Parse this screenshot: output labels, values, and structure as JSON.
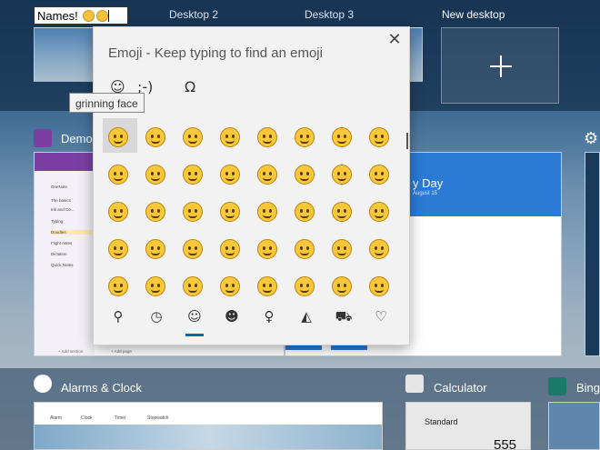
{
  "desktops": {
    "rename_value": "Names!",
    "desktop2": "Desktop 2",
    "desktop3": "Desktop 3",
    "new_desktop": "New desktop"
  },
  "windows": {
    "onenote_title": "Demo",
    "alarms_title": "Alarms & Clock",
    "calculator_title": "Calculator",
    "bing_title": "Bing",
    "calc_mode": "Standard",
    "calc_display": "555",
    "todo_header": "y Day",
    "todo_sub": "August 15",
    "onenote_pages": [
      "OneNote",
      "The basics",
      "Ink and Co...",
      "Typing",
      "Doodles",
      "Flight notes",
      "Dictation",
      "Quick Notes"
    ],
    "onenote_add_section": "+ Add section",
    "onenote_add_page": "+ Add page",
    "alarms_tabs": [
      "Alarm",
      "Clock",
      "Timer",
      "Stopwatch"
    ]
  },
  "emoji_panel": {
    "title": "Emoji - Keep typing to find an emoji",
    "close_glyph": "✕",
    "tabs": [
      "☺",
      ";-)",
      "Ω"
    ],
    "tooltip": "grinning face",
    "category_icons": [
      "search-icon",
      "clock-icon",
      "smiley-icon",
      "people-icon",
      "balloon-icon",
      "pizza-icon",
      "car-icon",
      "heart-icon"
    ],
    "emoji_rows": 5,
    "emoji_cols": 8
  },
  "colors": {
    "accent": "#0067c0",
    "emoji_yellow": "#f8c83a",
    "onenote_purple": "#7b3fa3",
    "todo_blue": "#2b7bd6"
  }
}
